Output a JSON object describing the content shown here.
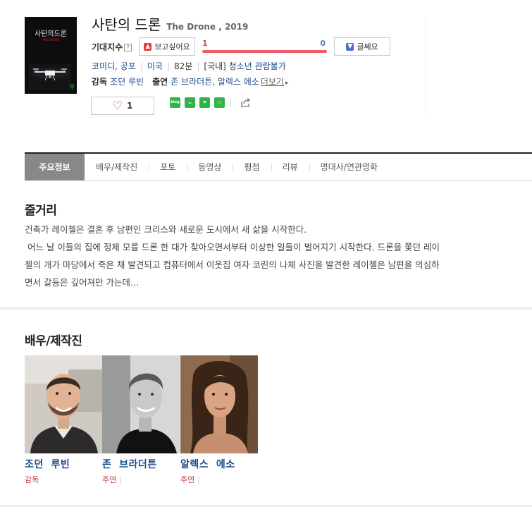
{
  "movie": {
    "title_ko": "사탄의 드론",
    "title_en": "The Drone , 2019",
    "poster_title": "사탄의드론",
    "poster_subtitle": "THE DRONE"
  },
  "expectation": {
    "label": "기대지수",
    "help": "?",
    "want_label": "보고싶어요",
    "want_count": "1",
    "nah_count": "0",
    "nah_label": "글쎄요",
    "want_ratio": 1.0,
    "accent_pos": "#ef5b68",
    "accent_neg": "#dfe6f5"
  },
  "info": {
    "genre": "코미디, 공포",
    "country": "미국",
    "runtime": "82분",
    "rating_prefix": "[국내]",
    "rating": "청소년 관람불가",
    "director_label": "감독",
    "director": "조던 루빈",
    "cast_label": "출연",
    "cast": "존 브라더튼, 알렉스 에소",
    "more": "더보기"
  },
  "like": {
    "count": "1"
  },
  "share": {
    "blog_label": "blog"
  },
  "tabs": [
    "주요정보",
    "배우/제작진",
    "포토",
    "동영상",
    "평점",
    "리뷰",
    "명대사/연관영화"
  ],
  "synopsis": {
    "title": "줄거리",
    "lines": [
      "건축가 레이첼은 결혼 후 남편인 크리스와 새로운 도시에서 새 삶을 시작한다.",
      " 어느 날 이들의 집에 정체 모를 드론 한 대가 찾아오면서부터 이상한 일들이 벌어지기 시작한다. 드론을 쫓던 레이",
      "첼의 개가 마당에서 죽은 채 발견되고 컴퓨터에서 이웃집 여자 코린의 나체 사진을 발견한 레이첼은 남편을 의심하",
      "면서 갈등은 깊어져만 가는데…"
    ]
  },
  "cast_section": {
    "title": "배우/제작진",
    "people": [
      {
        "name": "조던  루빈",
        "role": "감독",
        "has_bar": false
      },
      {
        "name": "존  브라더튼",
        "role": "주연",
        "has_bar": true
      },
      {
        "name": "알렉스  에소",
        "role": "주연",
        "has_bar": true
      }
    ]
  }
}
